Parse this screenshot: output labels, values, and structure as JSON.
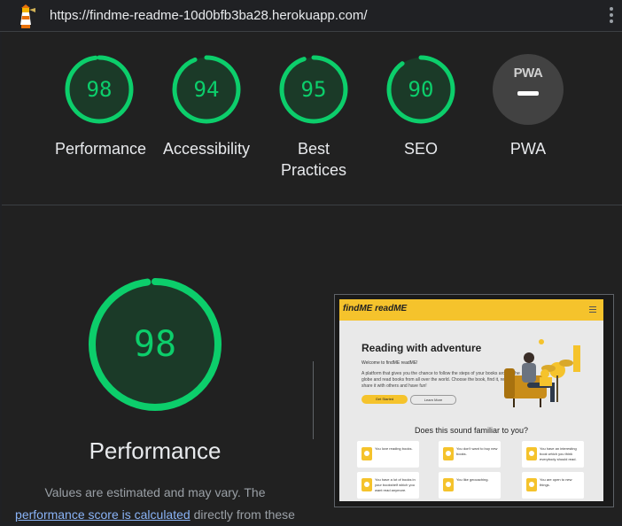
{
  "topbar": {
    "url": "https://findme-readme-10d0bfb3ba28.herokuapp.com/",
    "logo_icon": "lighthouse-icon",
    "menu_icon": "kebab-menu-icon"
  },
  "colors": {
    "pass": "#0cce6b",
    "na": "#424242"
  },
  "scores": [
    {
      "id": "performance",
      "value": "98",
      "score": 98,
      "label": "Performance"
    },
    {
      "id": "accessibility",
      "value": "94",
      "score": 94,
      "label": "Accessibility"
    },
    {
      "id": "best-practices",
      "value": "95",
      "score": 95,
      "label": "Best Practices"
    },
    {
      "id": "seo",
      "value": "90",
      "score": 90,
      "label": "SEO"
    }
  ],
  "pwa": {
    "badge": "PWA",
    "label": "PWA"
  },
  "detail": {
    "score": 98,
    "value": "98",
    "title": "Performance",
    "desc_before": "Values are estimated and may vary. The",
    "link": "performance score is calculated",
    "desc_after": "directly from these"
  },
  "screenshot": {
    "brand": "findME readME",
    "hero_title": "Reading with adventure",
    "welcome": "Welcome to findME readME!",
    "body": "A platform that gives you the chance to follow the steps of your books around the globe and read books from all over the world. Choose the book, find it, read it, share it with others and have fun!",
    "btn_start": "Get Started",
    "btn_more": "Learn More",
    "section_title": "Does this sound familiar to you?",
    "cards": [
      "You love reading books.",
      "You don't want to buy new books.",
      "You have an interesting book which you think everybody should read.",
      "You have a lot of books in your bookshelf which you want read anymore.",
      "You like geocaching.",
      "You are open to new things."
    ]
  }
}
